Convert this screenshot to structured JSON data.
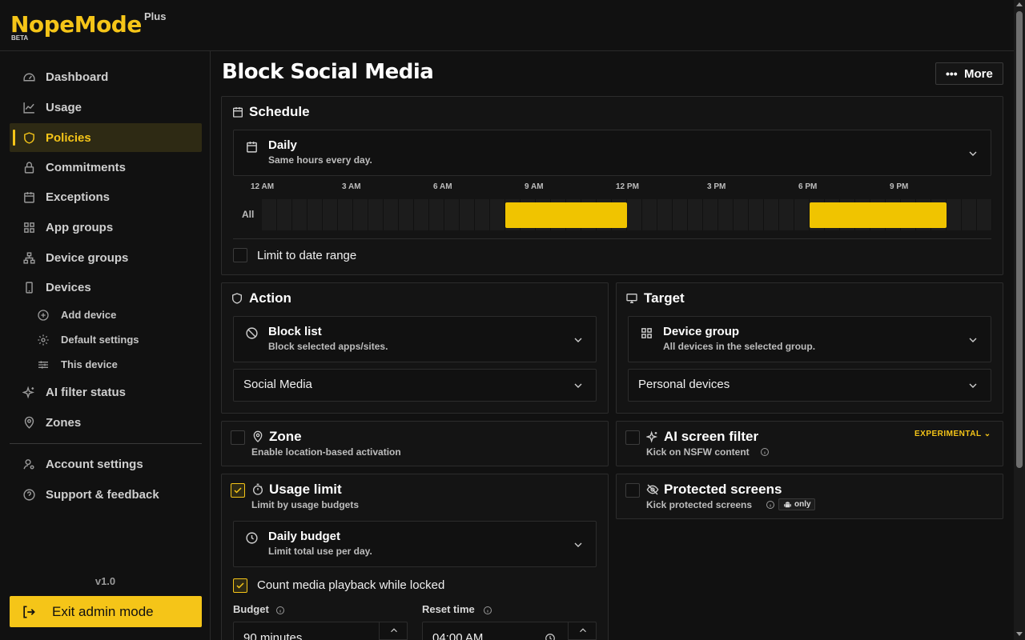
{
  "app": {
    "name": "NopeMode",
    "tier": "Plus",
    "stage": "BETA",
    "version": "v1.0"
  },
  "sidebar": {
    "items": [
      {
        "label": "Dashboard",
        "icon": "dashboard-icon"
      },
      {
        "label": "Usage",
        "icon": "chart-icon"
      },
      {
        "label": "Policies",
        "icon": "shield-icon",
        "active": true
      },
      {
        "label": "Commitments",
        "icon": "lock-icon"
      },
      {
        "label": "Exceptions",
        "icon": "calendar-icon"
      },
      {
        "label": "App groups",
        "icon": "grid-icon"
      },
      {
        "label": "Device groups",
        "icon": "hierarchy-icon"
      },
      {
        "label": "Devices",
        "icon": "phone-icon"
      }
    ],
    "device_subitems": [
      {
        "label": "Add device",
        "icon": "plus-circle-icon"
      },
      {
        "label": "Default settings",
        "icon": "gear-icon"
      },
      {
        "label": "This device",
        "icon": "sliders-icon"
      }
    ],
    "items_after": [
      {
        "label": "AI filter status",
        "icon": "sparkle-icon"
      },
      {
        "label": "Zones",
        "icon": "location-icon"
      }
    ],
    "footer_items": [
      {
        "label": "Account settings",
        "icon": "user-gear-icon"
      },
      {
        "label": "Support & feedback",
        "icon": "help-icon"
      }
    ],
    "exit_label": "Exit admin mode"
  },
  "page": {
    "title": "Block Social Media",
    "more_label": "More"
  },
  "schedule": {
    "title": "Schedule",
    "mode_title": "Daily",
    "mode_sub": "Same hours every day.",
    "time_labels": [
      "12 AM",
      "3 AM",
      "6 AM",
      "9 AM",
      "12 PM",
      "3 PM",
      "6 PM",
      "9 PM"
    ],
    "row_label": "All",
    "blocks": [
      {
        "start_hour": 8.0,
        "end_hour": 12.0
      },
      {
        "start_hour": 18.0,
        "end_hour": 22.5
      }
    ],
    "date_range_label": "Limit to date range",
    "date_range_checked": false
  },
  "action": {
    "title": "Action",
    "mode_title": "Block list",
    "mode_sub": "Block selected apps/sites.",
    "list_value": "Social Media"
  },
  "target": {
    "title": "Target",
    "mode_title": "Device group",
    "mode_sub": "All devices in the selected group.",
    "group_value": "Personal devices"
  },
  "zone": {
    "title": "Zone",
    "sub": "Enable location-based activation",
    "checked": false
  },
  "ai_filter": {
    "title": "AI screen filter",
    "sub": "Kick on NSFW content",
    "badge": "EXPERIMENTAL",
    "checked": false
  },
  "usage_limit": {
    "title": "Usage limit",
    "sub": "Limit by usage budgets",
    "checked": true,
    "mode_title": "Daily budget",
    "mode_sub": "Limit total use per day.",
    "count_media_label": "Count media playback while locked",
    "count_media_checked": true,
    "budget_label": "Budget",
    "budget_value": "90 minutes",
    "reset_label": "Reset time",
    "reset_value": "04:00 AM"
  },
  "protected_screens": {
    "title": "Protected screens",
    "sub": "Kick protected screens",
    "platform_badge": "only",
    "checked": false
  },
  "colors": {
    "accent": "#f5c518",
    "background": "#111111",
    "card": "#141414",
    "border": "#2c2c2c"
  }
}
